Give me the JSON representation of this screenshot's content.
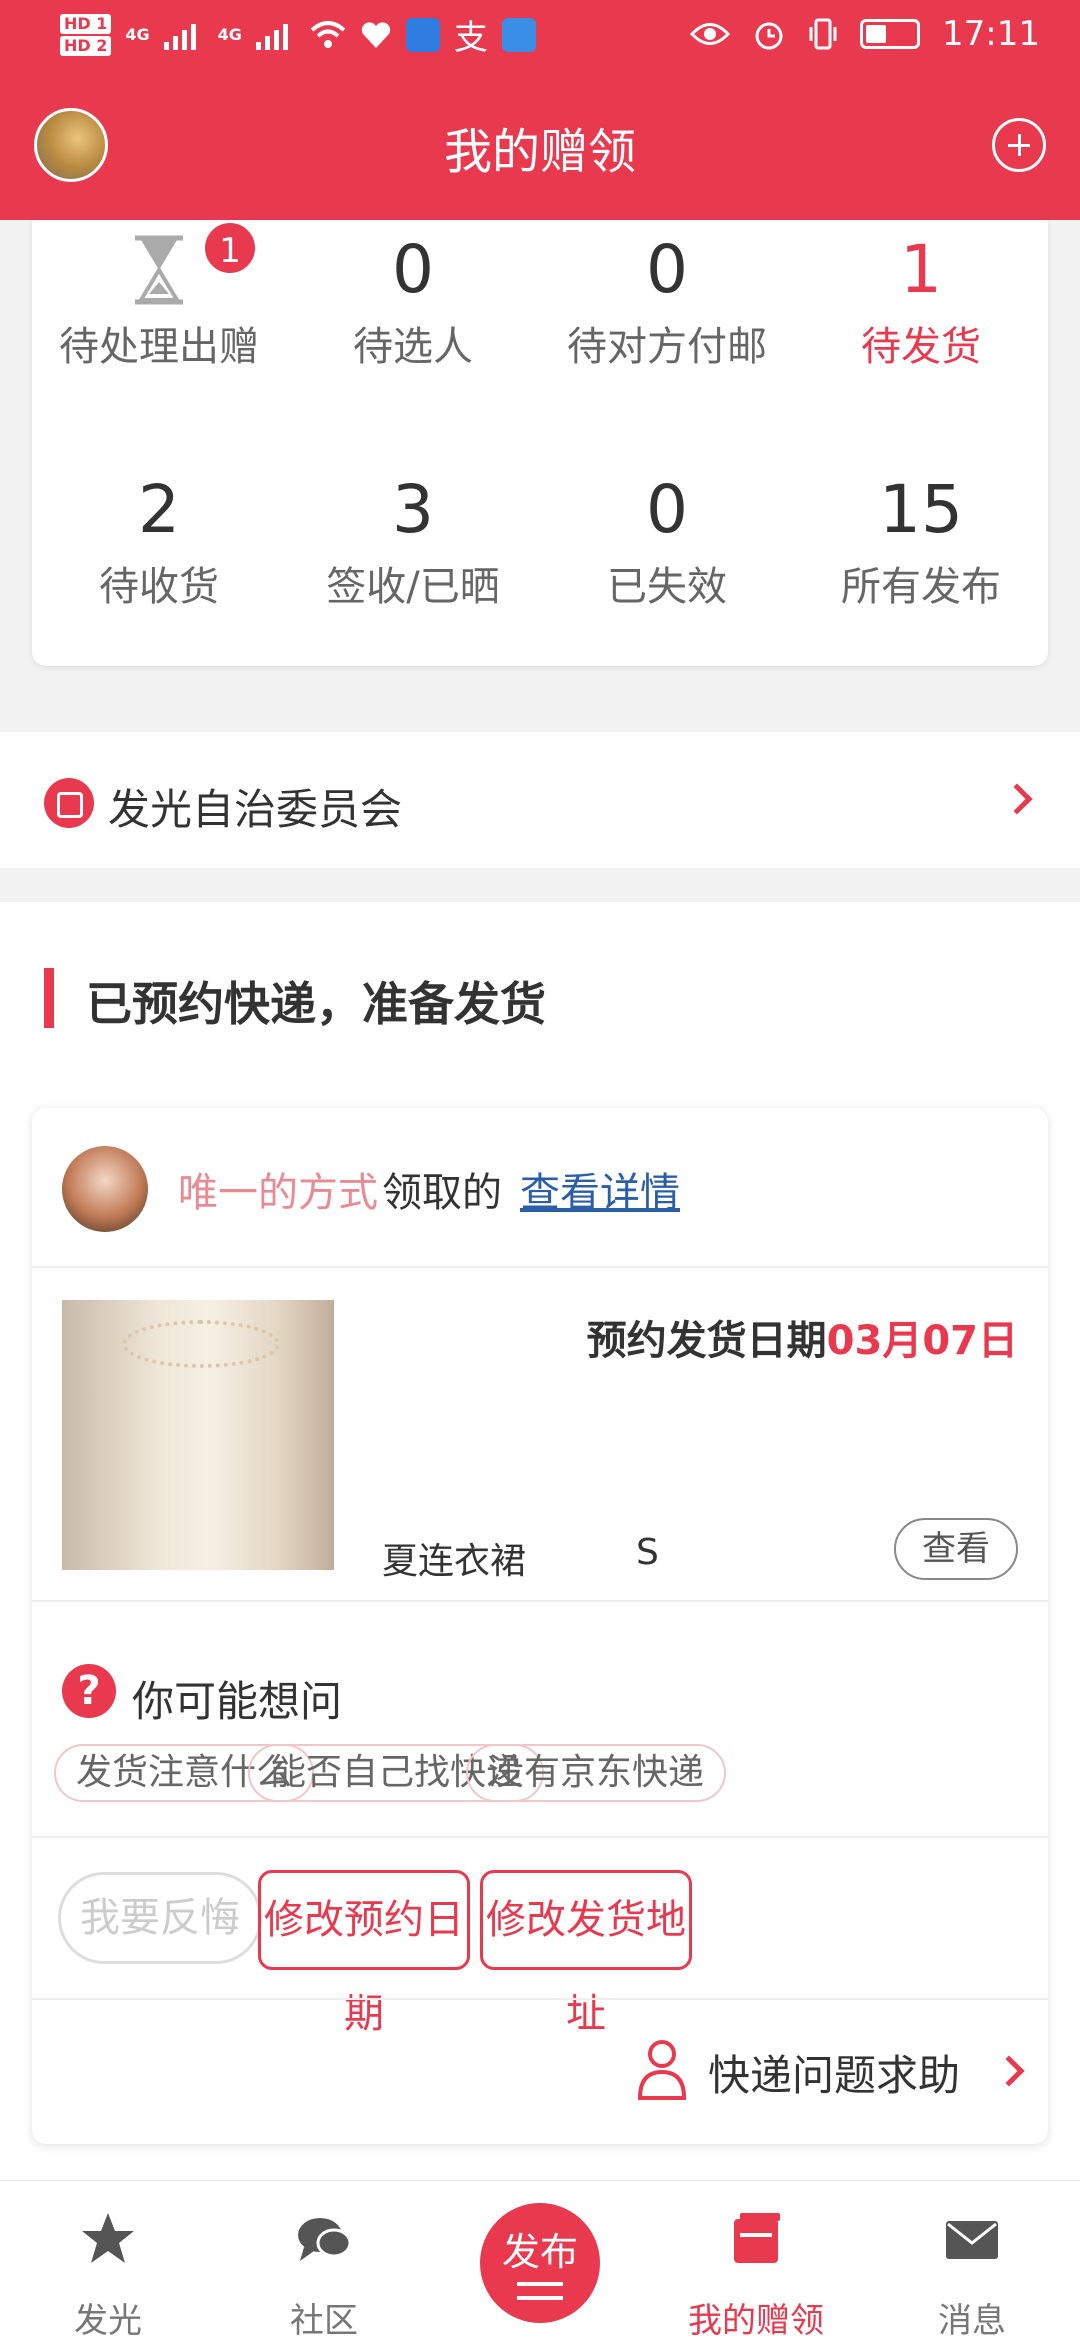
{
  "status_bar": {
    "hd1": "HD 1",
    "hd2": "HD 2",
    "net1": "4G",
    "net2": "4G",
    "alipay": "支",
    "time": "17:11"
  },
  "header": {
    "title": "我的赠领"
  },
  "stats": [
    {
      "value": "",
      "label": "待处理出赠",
      "badge": "1"
    },
    {
      "value": "0",
      "label": "待选人"
    },
    {
      "value": "0",
      "label": "待对方付邮"
    },
    {
      "value": "1",
      "label": "待发货"
    },
    {
      "value": "2",
      "label": "待收货"
    },
    {
      "value": "3",
      "label": "签收/已晒"
    },
    {
      "value": "0",
      "label": "已失效"
    },
    {
      "value": "15",
      "label": "所有发布"
    }
  ],
  "committee": {
    "label": "发光自治委员会"
  },
  "section": {
    "title": "已预约快递，准备发货"
  },
  "order": {
    "user_name": "唯一的方式",
    "action": "领取的",
    "detail_link": "查看详情",
    "ship_label": "预约发货日期",
    "ship_date": "03月07日",
    "product_name": "夏连衣裙",
    "product_size": "S",
    "view_button": "查看",
    "faq_title": "你可能想问",
    "faq_chips": [
      "发货注意什么",
      "能否自己找快递",
      "没有京东快递"
    ],
    "regret_button": "我要反悔",
    "change_date_button": "修改预约日期",
    "change_address_button": "修改发货地址",
    "help_label": "快递问题求助"
  },
  "bottom_nav": {
    "items": [
      "发光",
      "社区",
      "发布",
      "我的赠领",
      "消息"
    ],
    "active": "我的赠领"
  },
  "colors": {
    "accent": "#e8394f",
    "link": "#2c5ea8",
    "user_name": "#ea8a93"
  }
}
